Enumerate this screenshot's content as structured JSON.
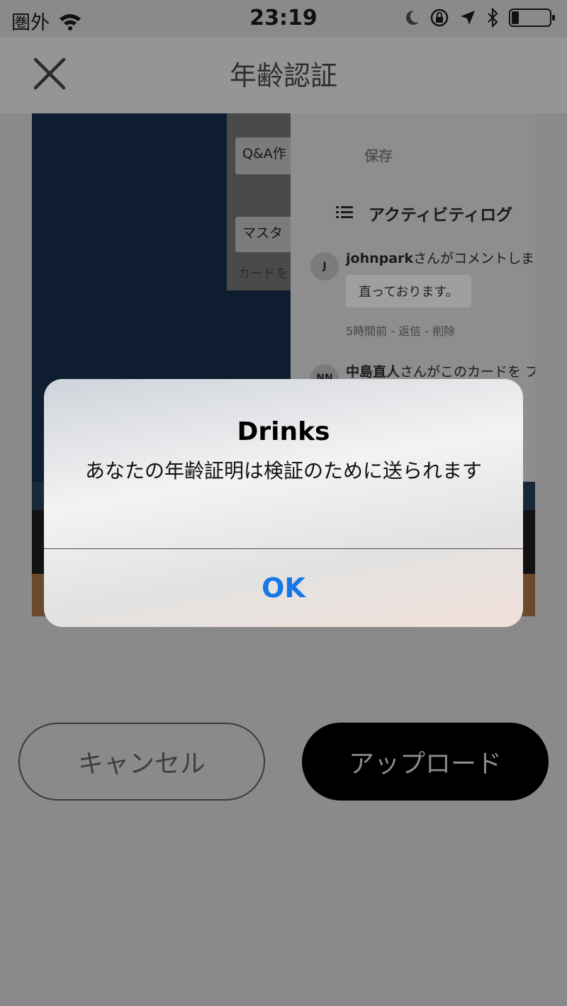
{
  "status_bar": {
    "carrier": "圏外",
    "time": "23:19",
    "icons": [
      "wifi-icon",
      "moon-icon",
      "rotation-lock-icon",
      "location-arrow-icon",
      "bluetooth-icon",
      "battery-icon"
    ],
    "battery_level": 0.2
  },
  "nav": {
    "title": "年齢認証",
    "close_icon": "close-icon"
  },
  "photo": {
    "left_panel": {
      "chip1": "Q&A作",
      "chip2": "マスタ",
      "hint": "カードを"
    },
    "right_panel": {
      "save_label": "保存",
      "section_title": "アクティビティログ",
      "comment1": {
        "avatar": "J",
        "user": "johnpark",
        "text": "さんがコメントしま",
        "bubble": "直っております。",
        "meta": "5時間前 - 返信 - 削除"
      },
      "comment2": {
        "avatar": "NN",
        "user": "中島直人",
        "text": "さんがこのカードを ブ"
      }
    }
  },
  "buttons": {
    "cancel": "キャンセル",
    "upload": "アップロード"
  },
  "alert": {
    "title": "Drinks",
    "message": "あなたの年齢証明は検証のために送られます",
    "ok": "OK"
  },
  "colors": {
    "dim_background": "#8a8a8a",
    "ok_blue": "#1677e6",
    "upload_bg": "#000000"
  }
}
